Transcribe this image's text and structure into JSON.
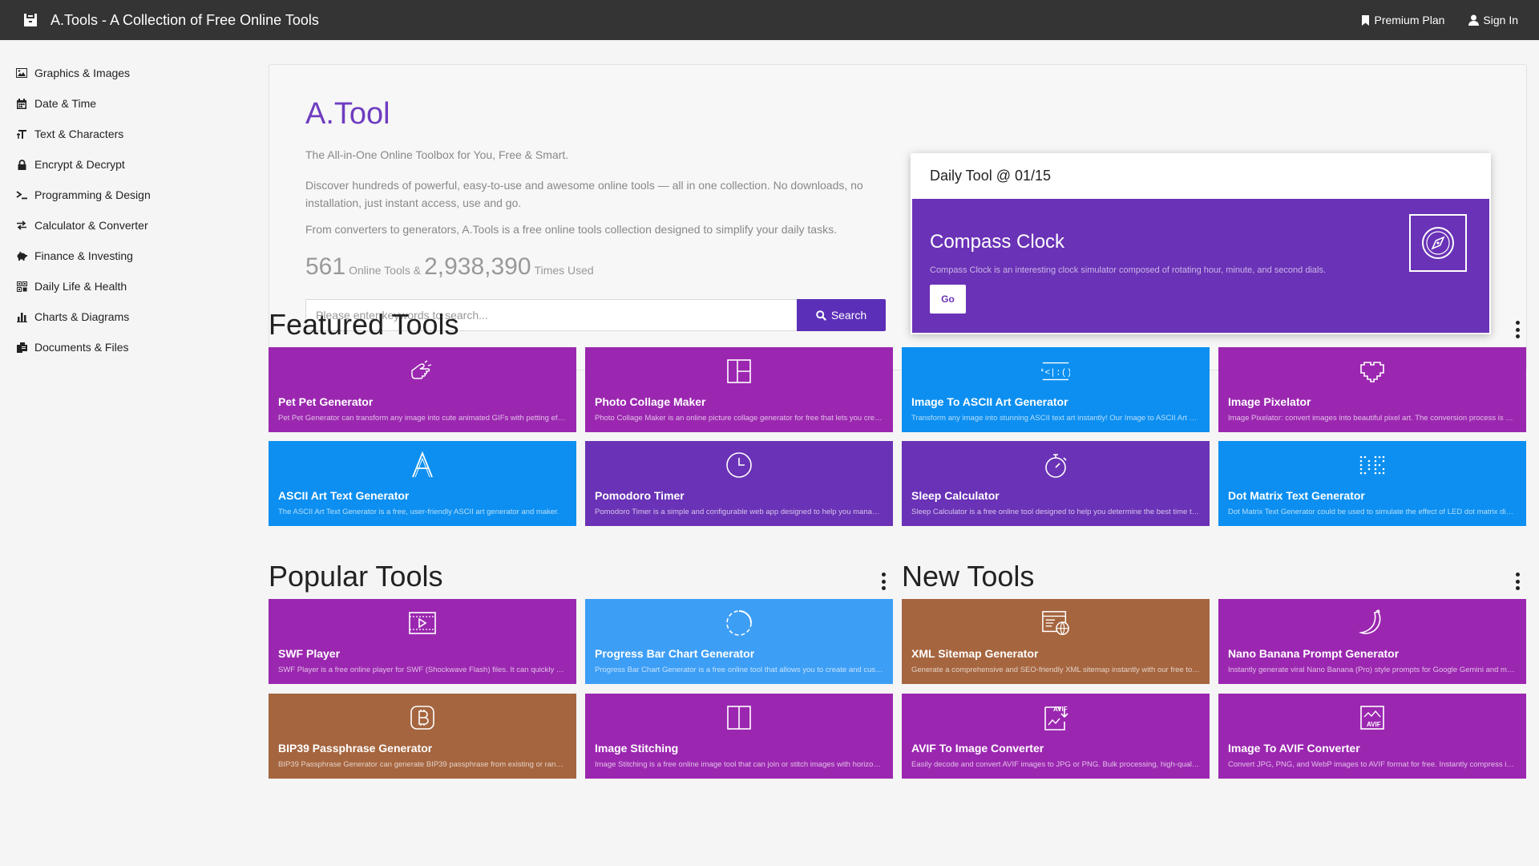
{
  "topbar": {
    "app_title": "A.Tools - A Collection of Free Online Tools",
    "premium_label": "Premium Plan",
    "signin_label": "Sign In"
  },
  "sidebar": {
    "items": [
      {
        "label": "Graphics & Images",
        "icon": "image-icon"
      },
      {
        "label": "Date & Time",
        "icon": "calendar-icon"
      },
      {
        "label": "Text & Characters",
        "icon": "text-icon"
      },
      {
        "label": "Encrypt & Decrypt",
        "icon": "lock-icon"
      },
      {
        "label": "Programming & Design",
        "icon": "terminal-icon"
      },
      {
        "label": "Calculator & Converter",
        "icon": "exchange-icon"
      },
      {
        "label": "Finance & Investing",
        "icon": "piggy-bank-icon"
      },
      {
        "label": "Daily Life & Health",
        "icon": "grid-icon"
      },
      {
        "label": "Charts & Diagrams",
        "icon": "bar-chart-icon"
      },
      {
        "label": "Documents & Files",
        "icon": "files-icon"
      }
    ]
  },
  "hero": {
    "brand": "A.Tool",
    "tagline": "The All-in-One Online Toolbox for You, Free & Smart.",
    "desc1": "Discover hundreds of powerful, easy-to-use and awesome online tools — all in one collection. No downloads, no installation, just instant access, use and go.",
    "desc2": "From converters to generators, A.Tools is a free online tools collection designed to simplify your daily tasks.",
    "tools_count": "561",
    "tools_label": "Online Tools &",
    "used_count": "2,938,390",
    "used_label": "Times Used",
    "search_placeholder": "Please enter keywords to search...",
    "search_button": "Search"
  },
  "daily": {
    "heading": "Daily Tool @ 01/15",
    "name": "Compass Clock",
    "description": "Compass Clock is an interesting clock simulator composed of rotating hour, minute, and second dials.",
    "go_label": "Go",
    "icon": "compass-icon"
  },
  "featured": {
    "title": "Featured Tools",
    "cards": [
      {
        "title": "Pet Pet Generator",
        "desc": "Pet Pet Generator can transform any image into cute animated GIFs with petting effect.",
        "color": "#9b27b0",
        "icon": "hand-pet-icon"
      },
      {
        "title": "Photo Collage Maker",
        "desc": "Photo Collage Maker is an online picture collage generator for free that lets you create collages.",
        "color": "#9b27b0",
        "icon": "collage-grid-icon"
      },
      {
        "title": "Image To ASCII Art Generator",
        "desc": "Transform any image into stunning ASCII text art instantly! Our Image to ASCII Art generator.",
        "color": "#0c8ff0",
        "icon": "ascii-face-icon"
      },
      {
        "title": "Image Pixelator",
        "desc": "Image Pixelator: convert images into beautiful pixel art. The conversion process is simple.",
        "color": "#9b27b0",
        "icon": "pixel-heart-icon"
      },
      {
        "title": "ASCII Art Text Generator",
        "desc": "The ASCII Art Text Generator is a free, user-friendly ASCII art generator and maker.",
        "color": "#0c8ff0",
        "icon": "letter-a-icon"
      },
      {
        "title": "Pomodoro Timer",
        "desc": "Pomodoro Timer is a simple and configurable web app designed to help you manage time.",
        "color": "#6a32b6",
        "icon": "clock-icon"
      },
      {
        "title": "Sleep Calculator",
        "desc": "Sleep Calculator is a free online tool designed to help you determine the best time to sleep.",
        "color": "#6a32b6",
        "icon": "stopwatch-icon"
      },
      {
        "title": "Dot Matrix Text Generator",
        "desc": "Dot Matrix Text Generator could be used to simulate the effect of LED dot matrix displays.",
        "color": "#0c8ff0",
        "icon": "dot-matrix-icon"
      }
    ]
  },
  "popular": {
    "title": "Popular Tools",
    "cards": [
      {
        "title": "SWF Player",
        "desc": "SWF Player is a free online player for SWF (Shockwave Flash) files. It can quickly play them.",
        "color": "#9b27b0",
        "icon": "video-player-icon"
      },
      {
        "title": "Progress Bar Chart Generator",
        "desc": "Progress Bar Chart Generator is a free online tool that allows you to create and customize charts.",
        "color": "#3d9ef5",
        "icon": "progress-circle-icon"
      },
      {
        "title": "BIP39 Passphrase Generator",
        "desc": "BIP39 Passphrase Generator can generate BIP39 passphrase from existing or random mnemonics.",
        "color": "#a5653f",
        "icon": "bitcoin-icon"
      },
      {
        "title": "Image Stitching",
        "desc": "Image Stitching is a free online image tool that can join or stitch images with horizontal layout.",
        "color": "#9b27b0",
        "icon": "split-panel-icon"
      }
    ]
  },
  "newtools": {
    "title": "New Tools",
    "cards": [
      {
        "title": "XML Sitemap Generator",
        "desc": "Generate a comprehensive and SEO-friendly XML sitemap instantly with our free tool.",
        "color": "#a5653f",
        "icon": "sitemap-globe-icon"
      },
      {
        "title": "Nano Banana Prompt Generator",
        "desc": "Instantly generate viral Nano Banana (Pro) style prompts for Google Gemini and more.",
        "color": "#9b27b0",
        "icon": "banana-icon"
      },
      {
        "title": "AVIF To Image Converter",
        "desc": "Easily decode and convert AVIF images to JPG or PNG. Bulk processing, high-quality output.",
        "color": "#9b27b0",
        "icon": "avif-export-icon"
      },
      {
        "title": "Image To AVIF Converter",
        "desc": "Convert JPG, PNG, and WebP images to AVIF format for free. Instantly compress images.",
        "color": "#9b27b0",
        "icon": "avif-import-icon"
      }
    ]
  }
}
